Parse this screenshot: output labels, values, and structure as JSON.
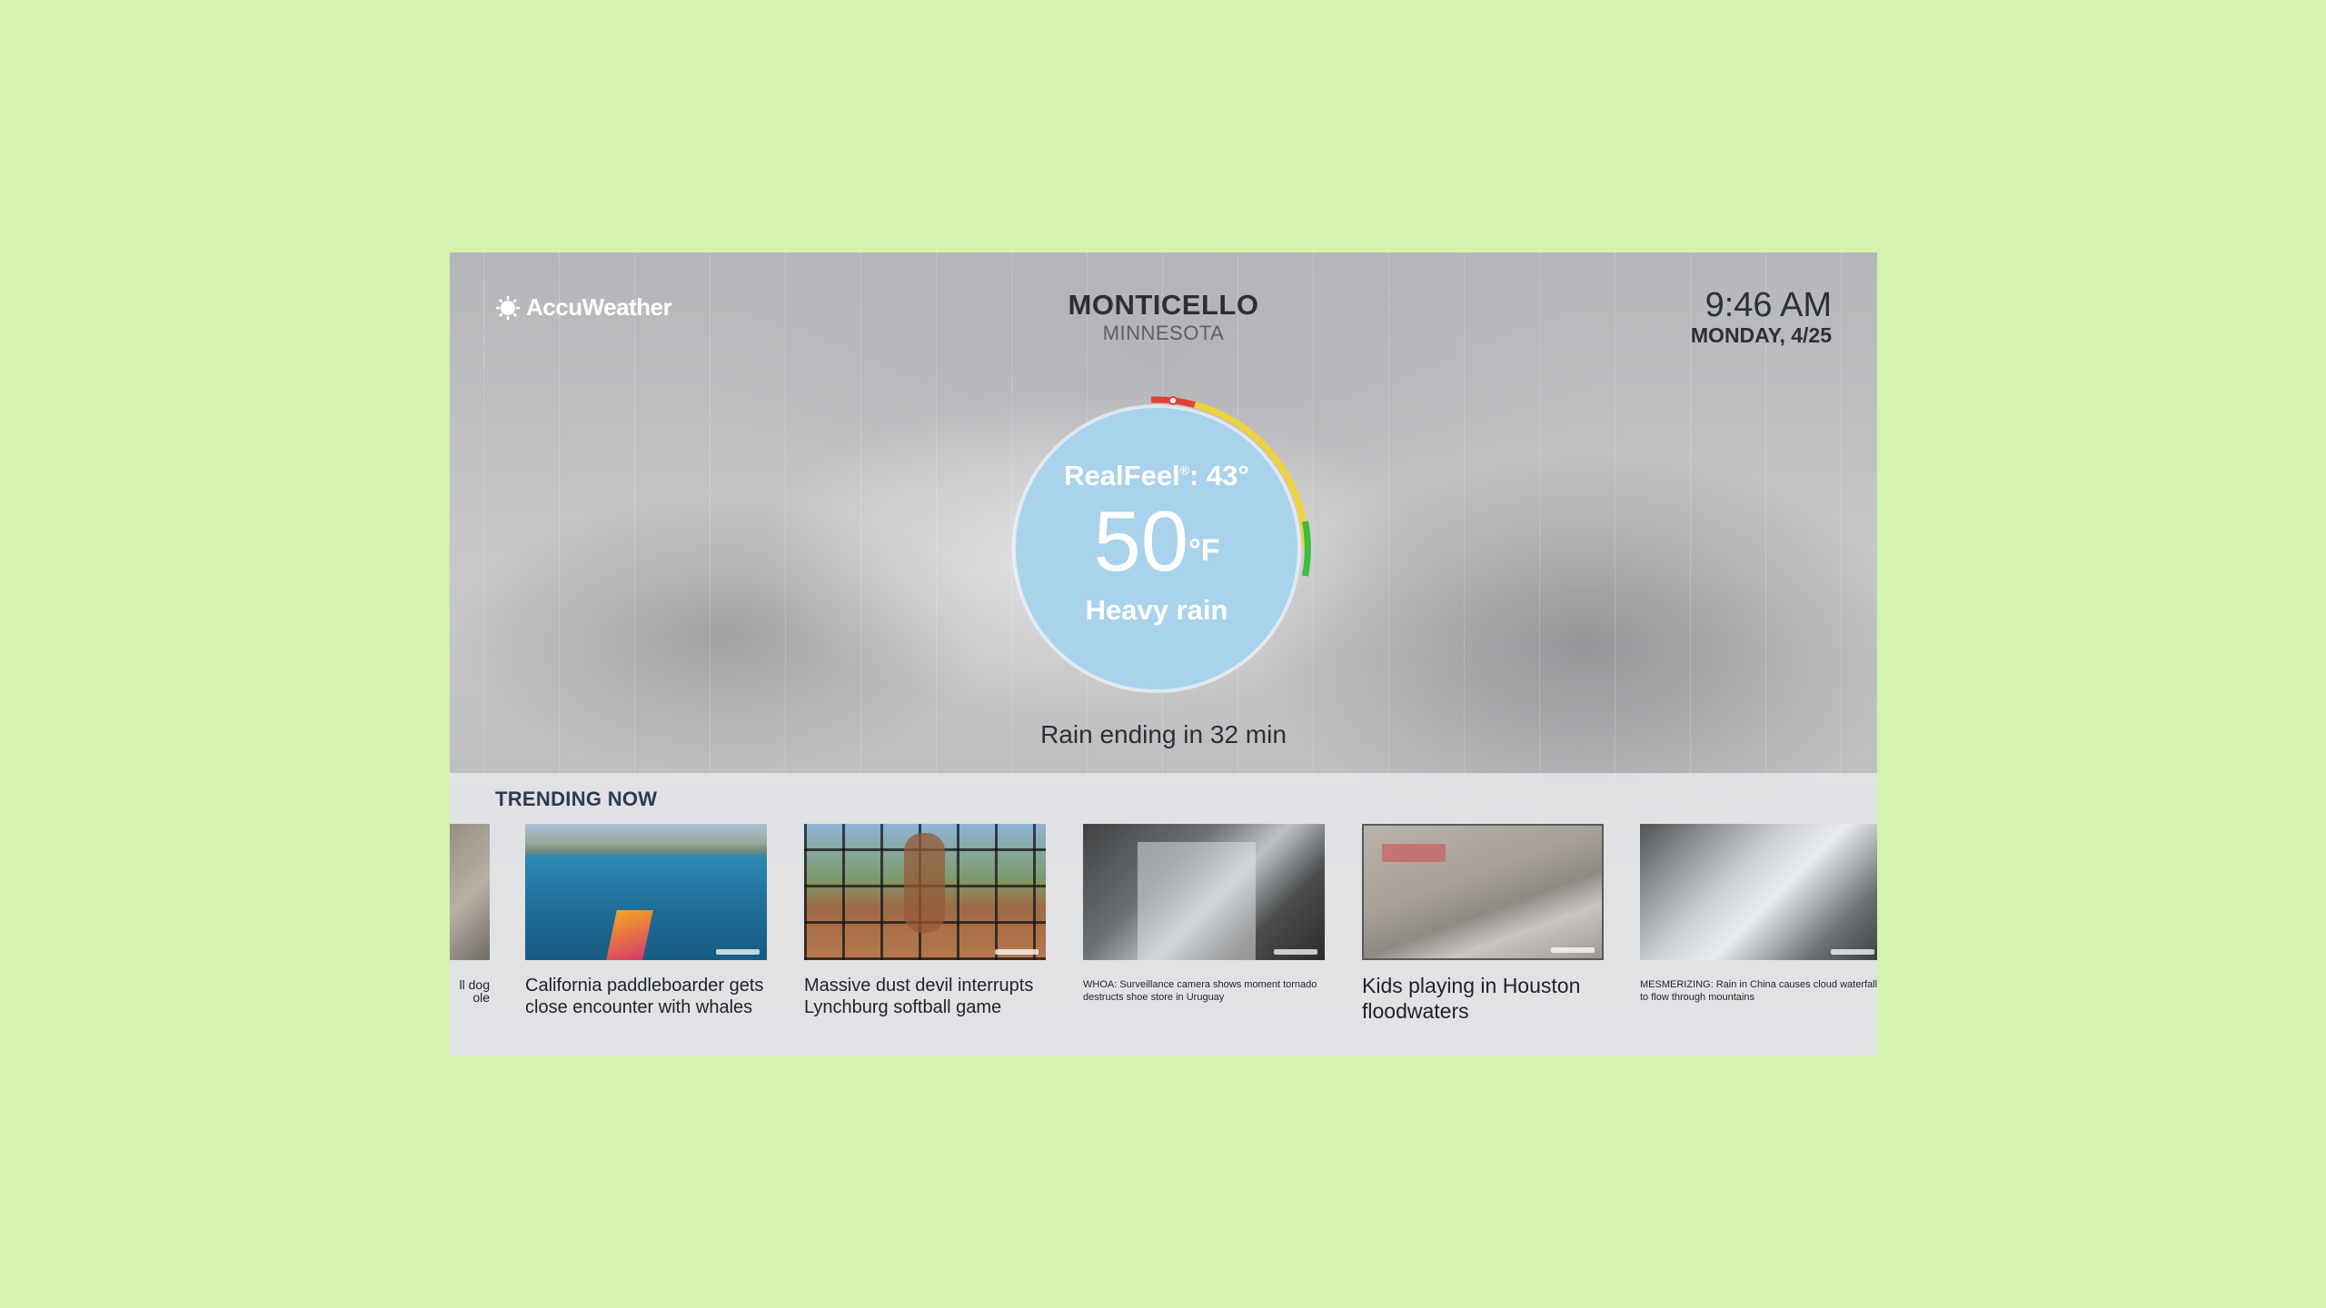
{
  "header": {
    "brand": "AccuWeather",
    "city": "MONTICELLO",
    "state": "MINNESOTA",
    "time": "9:46 AM",
    "date": "MONDAY, 4/25"
  },
  "current": {
    "realfeel_label": "RealFeel",
    "realfeel_mark": "®",
    "realfeel_value": ": 43°",
    "temperature": "50",
    "unit": "°F",
    "condition": "Heavy rain",
    "minutecast": "Rain ending in 32 min"
  },
  "trending": {
    "title": "TRENDING NOW",
    "cards": [
      {
        "caption": "ll dog\nole"
      },
      {
        "caption": "California paddleboarder gets close encounter with whales"
      },
      {
        "caption": "Massive dust devil interrupts Lynchburg softball game"
      },
      {
        "caption": "WHOA: Surveillance camera shows moment tornado destructs shoe store in Uruguay"
      },
      {
        "caption": "Kids playing in Houston floodwaters"
      },
      {
        "caption": "MESMERIZING: Rain in China causes cloud waterfall to flow through mountains"
      }
    ]
  },
  "colors": {
    "background": "#d5f2ae",
    "circle": "#a9d2ec",
    "gauge_red": "#e0423b",
    "gauge_yellow": "#f0d23a",
    "gauge_green": "#3dbb3d"
  }
}
